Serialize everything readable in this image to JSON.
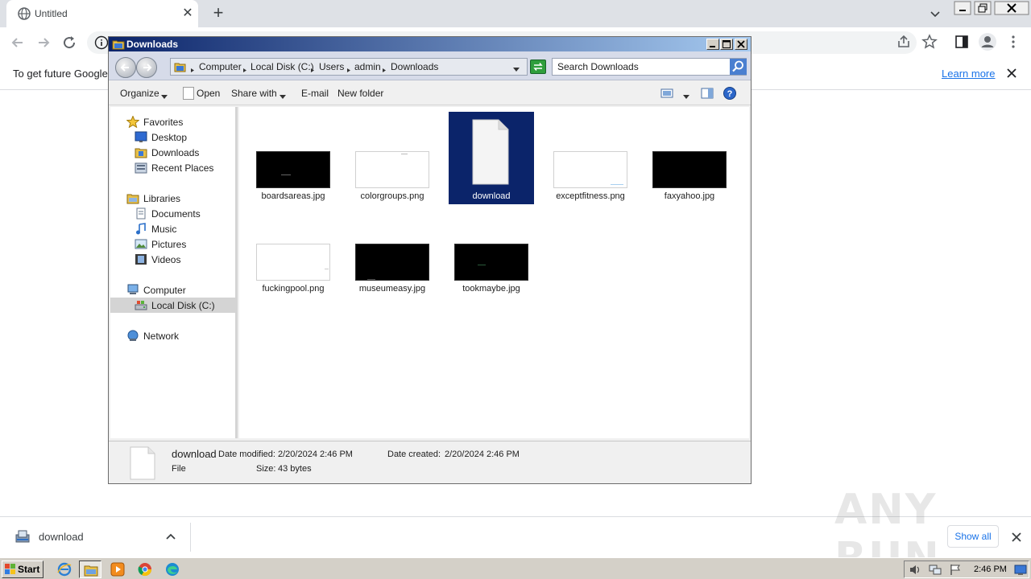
{
  "browser": {
    "tab_title": "Untitled",
    "new_tab": "+",
    "tab_close": "✕",
    "infobar_text": "To get future Google",
    "learn_more": "Learn more"
  },
  "explorer": {
    "title": "Downloads",
    "breadcrumbs": [
      "Computer",
      "Local Disk (C:)",
      "Users",
      "admin",
      "Downloads"
    ],
    "search_placeholder": "Search Downloads",
    "commands": {
      "organize": "Organize",
      "open": "Open",
      "share_with": "Share with",
      "email": "E-mail",
      "new_folder": "New folder"
    },
    "nav": {
      "favorites": "Favorites",
      "desktop": "Desktop",
      "downloads": "Downloads",
      "recent_places": "Recent Places",
      "libraries": "Libraries",
      "documents": "Documents",
      "music": "Music",
      "pictures": "Pictures",
      "videos": "Videos",
      "computer": "Computer",
      "local_disk": "Local Disk (C:)",
      "network": "Network"
    },
    "files": [
      {
        "name": "boardsareas.jpg",
        "thumb": "dark"
      },
      {
        "name": "colorgroups.png",
        "thumb": "light"
      },
      {
        "name": "download",
        "thumb": "document",
        "selected": true
      },
      {
        "name": "exceptfitness.png",
        "thumb": "light"
      },
      {
        "name": "faxyahoo.jpg",
        "thumb": "dark"
      },
      {
        "name": "fuckingpool.png",
        "thumb": "light"
      },
      {
        "name": "museumeasy.jpg",
        "thumb": "dark"
      },
      {
        "name": "tookmaybe.jpg",
        "thumb": "dark"
      }
    ],
    "details": {
      "name": "download",
      "modified_label": "Date modified:",
      "modified_value": "2/20/2024 2:46 PM",
      "created_label": "Date created:",
      "created_value": "2/20/2024 2:46 PM",
      "type": "File",
      "size_label": "Size:",
      "size_value": "43 bytes"
    }
  },
  "download_shelf": {
    "item_name": "download",
    "show_all": "Show all"
  },
  "watermark": "ANY RUN",
  "taskbar": {
    "start": "Start",
    "clock": "2:46 PM"
  }
}
